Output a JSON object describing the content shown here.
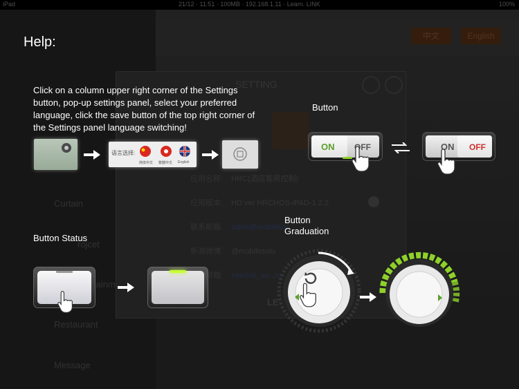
{
  "status_bar": {
    "device": "iPad",
    "center": "21/12 · 11:51 · 100MB · 192.168.1.11 · Learn. LINK",
    "battery": "100%"
  },
  "background_app": {
    "lang_buttons": [
      "中文",
      "English"
    ],
    "side_items": [
      "Curtain",
      "Restaurant",
      "Message"
    ],
    "side_partial": [
      "rojcet",
      "tainment"
    ],
    "panel": {
      "title": "SETTING",
      "rows": [
        {
          "label": "应用名称:",
          "value": "HRC(酒店客房控制)"
        },
        {
          "label": "应用版本:",
          "value": "HD ver HRCHOS-iPAD-1.2.2"
        },
        {
          "label": "联系邮箱:",
          "value": "sales@mobileux",
          "link": true
        },
        {
          "label": "新浪微博:",
          "value": "@mobilesoiu"
        },
        {
          "label": "反馈邮箱:",
          "value": "sevcice_su...m",
          "link": true
        }
      ],
      "footer_partial": "LE"
    }
  },
  "help": {
    "title": "Help:",
    "instructions": "Click on a column upper right corner of the Settings button, pop-up settings panel, select your preferred language, click the save button of the top right corner of the Settings panel language switching!",
    "language_popup": {
      "prompt": "语言选择:",
      "options": [
        "简体中文",
        "繁體中文",
        "English"
      ]
    },
    "button_label": "Button",
    "toggle": {
      "on": "ON",
      "off": "OFF"
    },
    "status_label": "Button Status",
    "graduation_label": "Button\nGraduation"
  },
  "colors": {
    "on_green": "#5aa02c",
    "off_red": "#d03030",
    "neutral_text": "#555555",
    "graduation_green": "#8fd12a",
    "active_glow": "#c6ff3a"
  },
  "icons": [
    "gear-icon",
    "china-flag-icon",
    "hongkong-flag-icon",
    "uk-flag-icon",
    "save-icon",
    "arrow-right-icon",
    "swap-arrows-icon",
    "hand-pointer-icon",
    "rotate-arrow-icon"
  ]
}
